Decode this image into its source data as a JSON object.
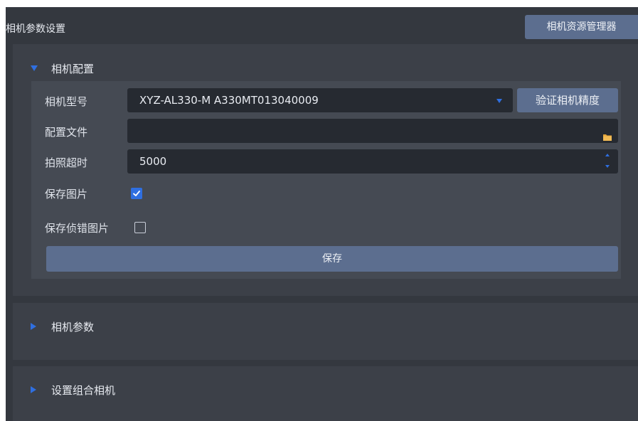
{
  "window": {
    "title": "相机参数设置",
    "resource_manager_label": "相机资源管理器"
  },
  "camera_config": {
    "header": "相机配置",
    "expanded": true,
    "model_label": "相机型号",
    "model_value": "XYZ-AL330-M A330MT013040009",
    "verify_label": "验证相机精度",
    "config_file_label": "配置文件",
    "config_file_value": "",
    "timeout_label": "拍照超时",
    "timeout_value": "5000",
    "save_image_label": "保存图片",
    "save_image_checked": true,
    "save_error_image_label": "保存侦错图片",
    "save_error_image_checked": false,
    "save_label": "保存"
  },
  "camera_params": {
    "header": "相机参数",
    "expanded": false
  },
  "combo_camera": {
    "header": "设置组合相机",
    "expanded": false
  },
  "colors": {
    "accent": "#2f6fe0",
    "button": "#5c6e8f",
    "folder": "#e5a53a",
    "panel_bg": "#34383f"
  },
  "icons": [
    "triangle-down-icon",
    "triangle-right-icon",
    "dropdown-arrow-icon",
    "folder-icon",
    "spinner-up-icon",
    "spinner-down-icon",
    "checkmark-icon"
  ]
}
